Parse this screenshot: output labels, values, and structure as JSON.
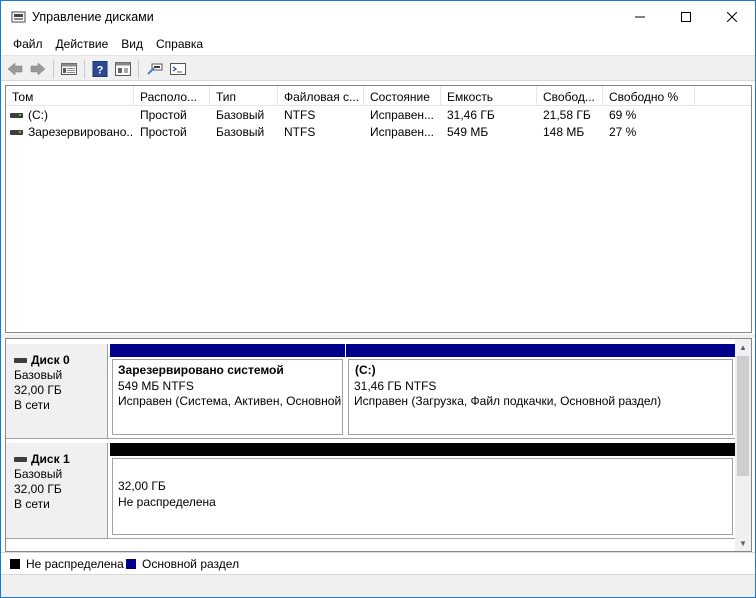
{
  "window": {
    "title": "Управление дисками",
    "controls": {
      "minimize": "—",
      "maximize": "☐",
      "close": "✕"
    }
  },
  "menu": [
    "Файл",
    "Действие",
    "Вид",
    "Справка"
  ],
  "toolbar_icons": [
    "back-arrow-icon",
    "forward-arrow-icon",
    "list-view-icon",
    "help-icon",
    "properties-icon",
    "connect-icon",
    "settings-icon"
  ],
  "volume_list": {
    "headers": [
      "Том",
      "Располо...",
      "Тип",
      "Файловая с...",
      "Состояние",
      "Емкость",
      "Свобод...",
      "Свободно %"
    ],
    "rows": [
      [
        "(C:)",
        "Простой",
        "Базовый",
        "NTFS",
        "Исправен...",
        "31,46 ГБ",
        "21,58 ГБ",
        "69 %"
      ],
      [
        "Зарезервировано...",
        "Простой",
        "Базовый",
        "NTFS",
        "Исправен...",
        "549 МБ",
        "148 МБ",
        "27 %"
      ]
    ]
  },
  "disks": [
    {
      "name": "Диск 0",
      "type": "Базовый",
      "size": "32,00 ГБ",
      "status": "В сети",
      "partitions": [
        {
          "name": "Зарезервировано системой",
          "size": "549 МБ NTFS",
          "status": "Исправен (Система, Активен, Основной",
          "bar_color": "#00008b"
        },
        {
          "name": "(C:)",
          "size": "31,46 ГБ NTFS",
          "status": "Исправен (Загрузка, Файл подкачки, Основной раздел)",
          "bar_color": "#00008b"
        }
      ]
    },
    {
      "name": "Диск 1",
      "type": "Базовый",
      "size": "32,00 ГБ",
      "status": "В сети",
      "partitions": [
        {
          "size": "32,00 ГБ",
          "status": "Не распределена",
          "bar_color": "#000000"
        }
      ]
    }
  ],
  "legend": [
    {
      "label": "Не распределена",
      "color": "#000000"
    },
    {
      "label": "Основной раздел",
      "color": "#00008b"
    }
  ]
}
